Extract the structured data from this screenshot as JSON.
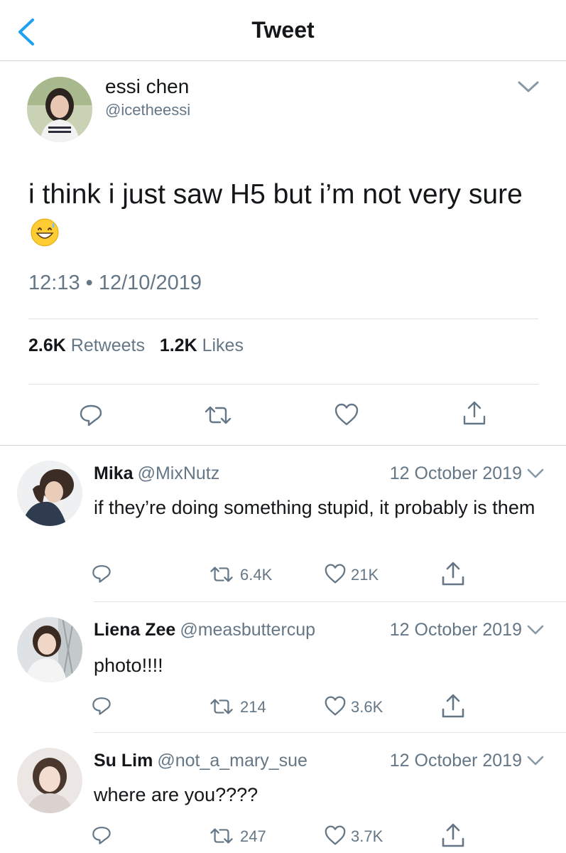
{
  "header": {
    "title": "Tweet",
    "back_icon": "chevron-left-icon"
  },
  "tweet": {
    "author_name": "essi chen",
    "author_handle": "@icetheessi",
    "text": "i think i just saw H5 but i’m not very sure",
    "emoji": "grinning-face-with-sweat",
    "timestamp": "12:13 • 12/10/2019",
    "retweets_count": "2.6K",
    "retweets_label": "Retweets",
    "likes_count": "1.2K",
    "likes_label": "Likes"
  },
  "replies": [
    {
      "name": "Mika",
      "handle": "@MixNutz",
      "date": "12 October 2019",
      "text": "if they’re doing something stupid, it probably is them",
      "retweets": "6.4K",
      "likes": "21K"
    },
    {
      "name": "Liena Zee",
      "handle": "@measbuttercup",
      "date": "12 October 2019",
      "text": "photo!!!!",
      "retweets": "214",
      "likes": "3.6K"
    },
    {
      "name": "Su Lim",
      "handle": "@not_a_mary_sue",
      "date": "12 October 2019",
      "text": "where are you????",
      "retweets": "247",
      "likes": "3.7K"
    }
  ],
  "colors": {
    "accent": "#1da1f2",
    "secondary_text": "#657786",
    "primary_text": "#14171a",
    "divider": "#dfe3e7"
  }
}
